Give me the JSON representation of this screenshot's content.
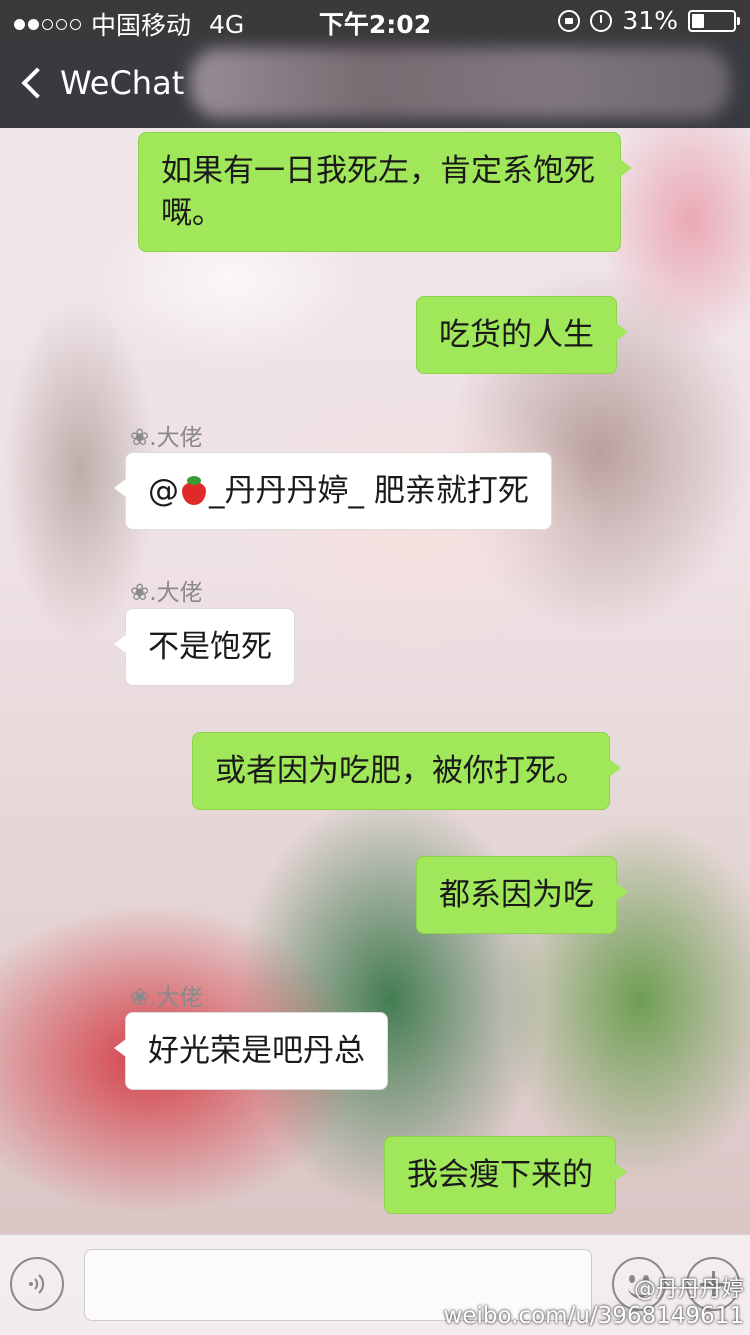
{
  "status_bar": {
    "signal_dots": [
      true,
      true,
      false,
      false,
      false
    ],
    "carrier": "中国移动",
    "network": "4G",
    "time": "下午2:02",
    "battery_text": "31%",
    "battery_level": 0.31,
    "icons": [
      "orientation-lock-icon",
      "alarm-icon",
      "battery-icon"
    ]
  },
  "nav": {
    "back_label": "WeChat"
  },
  "messages": [
    {
      "side": "sent",
      "text": "如果有一日我死左，肯定系饱死嘅。"
    },
    {
      "side": "sent",
      "text": "吃货的人生"
    },
    {
      "side": "received",
      "sender": "❀.大佬",
      "text_before": "@",
      "emoji": "strawberry-icon",
      "text_after": "_丹丹丹婷_ 肥亲就打死"
    },
    {
      "side": "received",
      "sender": "❀.大佬",
      "text": "不是饱死"
    },
    {
      "side": "sent",
      "text": "或者因为吃肥，被你打死。"
    },
    {
      "side": "sent",
      "text": "都系因为吃"
    },
    {
      "side": "received",
      "sender": "❀.大佬",
      "text": "好光荣是吧丹总"
    },
    {
      "side": "sent",
      "text": "我会瘦下来的"
    }
  ],
  "input_bar": {
    "value": "",
    "icons": [
      "voice-icon",
      "emoji-icon",
      "plus-icon"
    ]
  },
  "watermark": {
    "user": "@丹丹丹婷",
    "url": "weibo.com/u/3968149611"
  },
  "colors": {
    "status_bar": "#3a3a3a",
    "nav_bar": "#393a3f",
    "sent_bubble": "#a0e75a",
    "received_bubble": "#ffffff"
  }
}
